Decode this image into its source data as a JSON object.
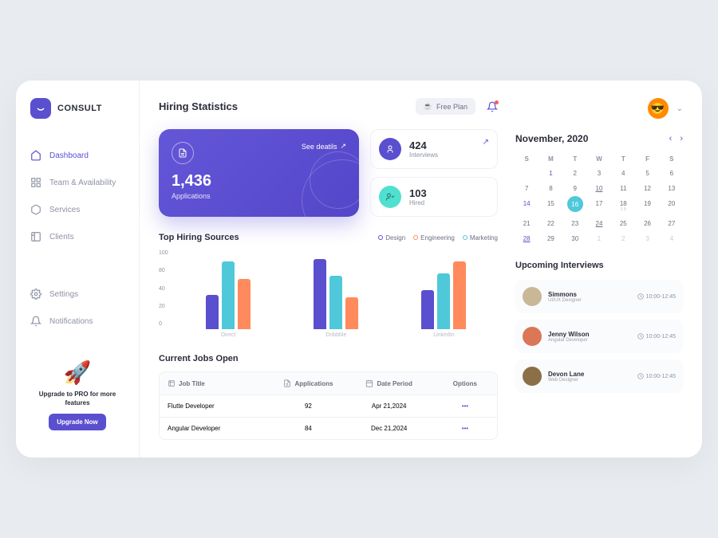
{
  "brand": "CONSULT",
  "nav": {
    "items": [
      {
        "label": "Dashboard",
        "icon": "home"
      },
      {
        "label": "Team & Availability",
        "icon": "grid"
      },
      {
        "label": "Services",
        "icon": "box"
      },
      {
        "label": "Clients",
        "icon": "users"
      }
    ],
    "secondary": [
      {
        "label": "Settings",
        "icon": "gear"
      },
      {
        "label": "Notifications",
        "icon": "bell"
      }
    ]
  },
  "promo": {
    "text": "Upgrade to PRO for more features",
    "button": "Upgrade Now"
  },
  "header": {
    "title": "Hiring Statistics",
    "plan": "Free Plan"
  },
  "cards": {
    "applications": {
      "value": "1,436",
      "label": "Applications",
      "link": "See deatils"
    },
    "interviews": {
      "value": "424",
      "label": "Interviews"
    },
    "hired": {
      "value": "103",
      "label": "Hired"
    }
  },
  "sources": {
    "title": "Top Hiring Sources",
    "legend": [
      {
        "label": "Design",
        "color": "#5a4fcf"
      },
      {
        "label": "Engineering",
        "color": "#ff8a5c"
      },
      {
        "label": "Marketing",
        "color": "#4fc9d9"
      }
    ]
  },
  "chart_data": {
    "type": "bar",
    "title": "Top Hiring Sources",
    "categories": [
      "Direct",
      "Dribbble",
      "LinkedIn"
    ],
    "ylabel": "",
    "ylim": [
      0,
      100
    ],
    "yticks": [
      100,
      80,
      40,
      20,
      0
    ],
    "series": [
      {
        "name": "Design",
        "color": "#5a4fcf",
        "values": [
          48,
          98,
          55
        ]
      },
      {
        "name": "Marketing",
        "color": "#4fc9d9",
        "values": [
          95,
          75,
          78
        ]
      },
      {
        "name": "Engineering",
        "color": "#ff8a5c",
        "values": [
          70,
          45,
          95
        ]
      }
    ]
  },
  "jobs": {
    "title": "Current Jobs Open",
    "columns": [
      "Job Title",
      "Applications",
      "Date Period",
      "Options"
    ],
    "rows": [
      {
        "title": "Flutte Developer",
        "apps": "92",
        "date": "Apr 21,2024"
      },
      {
        "title": "Angular Developer",
        "apps": "84",
        "date": "Dec 21,2024"
      }
    ]
  },
  "calendar": {
    "title": "November, 2020",
    "dow": [
      "S",
      "M",
      "T",
      "W",
      "T",
      "F",
      "S"
    ],
    "weeks": [
      [
        {
          "d": "",
          "dim": true
        },
        {
          "d": "1",
          "hl": true
        },
        {
          "d": "2"
        },
        {
          "d": "3"
        },
        {
          "d": "4"
        },
        {
          "d": "5"
        },
        {
          "d": "6"
        }
      ],
      [
        {
          "d": "7"
        },
        {
          "d": "8"
        },
        {
          "d": "9"
        },
        {
          "d": "10",
          "dot": true
        },
        {
          "d": "11"
        },
        {
          "d": "12"
        },
        {
          "d": "13"
        }
      ],
      [
        {
          "d": "14",
          "hl": true
        },
        {
          "d": "15"
        },
        {
          "d": "16",
          "sel": true
        },
        {
          "d": "17"
        },
        {
          "d": "18",
          "badge": "1 9"
        },
        {
          "d": "19"
        },
        {
          "d": "20"
        }
      ],
      [
        {
          "d": "21"
        },
        {
          "d": "22"
        },
        {
          "d": "23"
        },
        {
          "d": "24",
          "dot": true
        },
        {
          "d": "25"
        },
        {
          "d": "26"
        },
        {
          "d": "27"
        }
      ],
      [
        {
          "d": "28",
          "dot": true,
          "hl": true
        },
        {
          "d": "29"
        },
        {
          "d": "30"
        },
        {
          "d": "1",
          "dim": true
        },
        {
          "d": "2",
          "dim": true
        },
        {
          "d": "3",
          "dim": true
        },
        {
          "d": "4",
          "dim": true
        }
      ]
    ]
  },
  "upcoming": {
    "title": "Upcoming Interviews",
    "items": [
      {
        "name": "Simmons",
        "role": "UI/UX Designer",
        "time": "10:00-12:45",
        "color": "#c9b896"
      },
      {
        "name": "Jenny Wilson",
        "role": "Angular Developer",
        "time": "10:00-12:45",
        "color": "#d97757"
      },
      {
        "name": "Devon Lane",
        "role": "Web Designer",
        "time": "10:00-12:45",
        "color": "#8b6f47"
      }
    ]
  }
}
